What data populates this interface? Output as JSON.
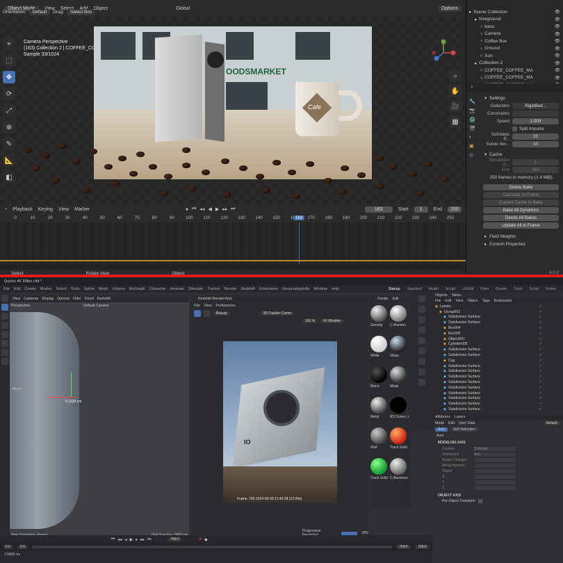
{
  "blender": {
    "header": {
      "mode": "Object Mode",
      "menus": [
        "View",
        "Select",
        "Add",
        "Object"
      ],
      "orientation_label": "Orientation:",
      "orientation": "Default",
      "drag_label": "Drag:",
      "drag": "Select Box",
      "transform": "Global",
      "options": "Options"
    },
    "overlay": {
      "line1": "Camera Perspective",
      "line2": "(163) Collection 2 | COFFEE_COFFEE_MAT_0.002",
      "line3": "Sample 33/1024"
    },
    "render": {
      "sign": "OODSMARKET",
      "cup_label": "Cafe"
    },
    "outliner": {
      "rows": [
        {
          "label": "Scene Collection",
          "indent": 0
        },
        {
          "label": "foreground",
          "indent": 1
        },
        {
          "label": "baso",
          "indent": 2
        },
        {
          "label": "Camera",
          "indent": 2
        },
        {
          "label": "Coffee Box",
          "indent": 2
        },
        {
          "label": "Ground",
          "indent": 2
        },
        {
          "label": "Sun",
          "indent": 2
        },
        {
          "label": "Collection 2",
          "indent": 1
        },
        {
          "label": "COFFEE_COFFEE_MA",
          "indent": 2
        },
        {
          "label": "COFFEE_COFFEE_MA",
          "indent": 2
        },
        {
          "label": "COFFEE_COFFEE_MA",
          "indent": 2
        }
      ]
    },
    "props": {
      "settings": "Settings",
      "collection_label": "Collection",
      "collection": "RigidBod...",
      "constraints_label": "Constraints",
      "speed_label": "Speed",
      "speed": "1.000",
      "split": "Split Impulse",
      "substeps_label": "Substeps P...",
      "substeps": "10",
      "solver_label": "Solver Iter...",
      "solver": "10",
      "cache": "Cache",
      "sim_start_label": "Simulation S...",
      "sim_start": "1",
      "end_label": "End",
      "end": "250",
      "memory": "250 frames in memory (1.4 MiB).",
      "buttons": [
        {
          "label": "Delete Bake",
          "dim": false
        },
        {
          "label": "Calculate to Frame",
          "dim": true
        },
        {
          "label": "Current Cache to Bake",
          "dim": true
        },
        {
          "label": "Bake All Dynamics",
          "dim": false
        },
        {
          "label": "Delete All Bakes",
          "dim": false
        },
        {
          "label": "Update All to Frame",
          "dim": false
        }
      ],
      "field_weights": "Field Weights",
      "custom": "Custom Properties",
      "version": "4.0.0"
    },
    "timeline": {
      "playback": "Playback",
      "keying": "Keying",
      "view": "View",
      "marker": "Marker",
      "current": "163",
      "start_label": "Start",
      "start": "1",
      "end_label": "End",
      "end": "250",
      "ticks": [
        "0",
        "10",
        "20",
        "30",
        "40",
        "50",
        "60",
        "70",
        "80",
        "90",
        "100",
        "110",
        "120",
        "130",
        "140",
        "150",
        "160",
        "163",
        "170",
        "180",
        "190",
        "200",
        "210",
        "220",
        "230",
        "240",
        "250"
      ],
      "playhead_frame": 163
    },
    "status": {
      "select": "Select",
      "rotate": "Rotate View",
      "object": "Object"
    }
  },
  "c4d": {
    "menu": [
      "File",
      "Edit",
      "Create",
      "Modes",
      "Select",
      "Tools",
      "Spline",
      "Mesh",
      "Volume",
      "MoGraph",
      "Character",
      "Animate",
      "Simulate",
      "Tracker",
      "Render",
      "Redshift",
      "Extensions",
      "Greyscalegorilla",
      "Window",
      "Help"
    ],
    "title": "Quicks 4K 60fps.c4d *",
    "layouts": [
      "Startup",
      "Standard",
      "Model",
      "Sculpt",
      "UVEdit",
      "Paint",
      "Groom",
      "Track",
      "Script",
      "Nodes"
    ],
    "viewport": {
      "menus": [
        "View",
        "Cameras",
        "Display",
        "Options",
        "Filter",
        "Panel",
        "Redshift"
      ],
      "perspective": "Perspective",
      "camera": "Default Camera",
      "move": "Move",
      "dim_value": "5.1333 cm",
      "footer_left": "View Transform: Project",
      "footer_right": "Grid Spacing : 5000 cm"
    },
    "renderview": {
      "title": "Redshift RenderView",
      "menus": [
        "File",
        "View",
        "Preferences"
      ],
      "beauty": "Beauty",
      "camera": "3D Tracker Camer",
      "zoom": "100 %",
      "fit": "Fit Window",
      "frame": "Frame: 766  2024-09-30  21:46:28  (12.04s)",
      "progress": "Progressive Rendering...",
      "progress_pct": "18%",
      "badge": "IO"
    },
    "materials": {
      "menus": [
        "Create",
        "Edit"
      ],
      "items": [
        "Gemety",
        "C.Aluminu",
        "White",
        "Glass",
        "Black",
        "Metal",
        "Metal",
        "RS Dome Li",
        "Wall",
        "Track Solid",
        "Track Solid",
        "C.Aluminun"
      ]
    },
    "objects": {
      "tabs": [
        "Objects",
        "Takes"
      ],
      "menus": [
        "File",
        "Edit",
        "View",
        "Object",
        "Tags",
        "Bookmarks"
      ],
      "rows": [
        "Landry",
        "Group002",
        "Subdivision Surface",
        "Subdivision Surface",
        "Box004",
        "Box005",
        "Object001",
        "Cylinder005",
        "Subdivision Surface",
        "Subdivision Surface",
        "Cap",
        "Subdivision Surface",
        "Subdivision Surface",
        "Subdivision Surface",
        "Subdivision Surface",
        "Subdivision Surface",
        "Subdivision Surface",
        "Subdivision Surface",
        "Subdivision Surface",
        "Subdivision Surface"
      ]
    },
    "attributes": {
      "tabs": [
        "Attributes",
        "Layers"
      ],
      "menus": [
        "Mode",
        "Edit",
        "User Data"
      ],
      "preset": "Default",
      "mode_tabs": [
        "Axis",
        "Soft Selection"
      ],
      "section": "Axis",
      "sub1": "MODELING AXIS",
      "fields": [
        "Position",
        "Orientation",
        "Retain Changes",
        "Along Normals",
        "Object",
        "X",
        "Y",
        "Z"
      ],
      "pos_value": "Selected",
      "orient_value": "Axis",
      "sub2": "OBJECT AXIS",
      "per_object": "Per-Object Transform"
    },
    "timeline": {
      "frame": "768 F",
      "start": "0 F",
      "end": "768 F",
      "end2": "768 F",
      "left_val": "0 F",
      "status": "1.5826 cm"
    }
  }
}
